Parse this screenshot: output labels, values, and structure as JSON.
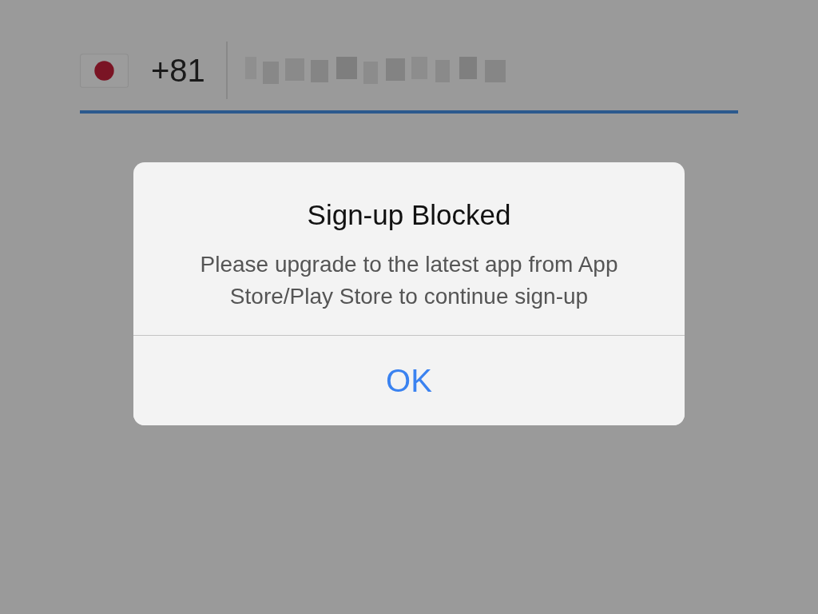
{
  "phone_field": {
    "country_code": "+81"
  },
  "dialog": {
    "title": "Sign-up Blocked",
    "message": "Please upgrade to the latest app from App Store/Play Store to continue sign-up",
    "buttons": [
      "OK"
    ]
  }
}
